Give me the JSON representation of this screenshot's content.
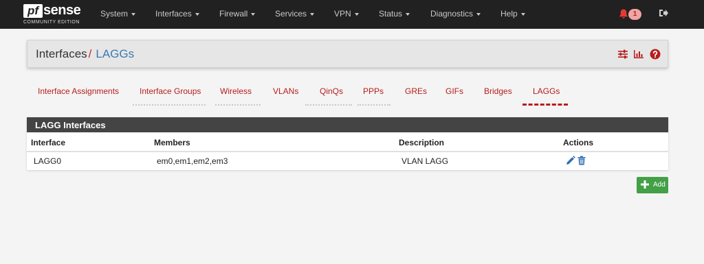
{
  "brand": {
    "logo_pf": "pf",
    "logo_sense": "sense",
    "edition": "COMMUNITY EDITION"
  },
  "nav": {
    "items": [
      "System",
      "Interfaces",
      "Firewall",
      "Services",
      "VPN",
      "Status",
      "Diagnostics",
      "Help"
    ],
    "notification_count": "1"
  },
  "breadcrumb": {
    "parent": "Interfaces",
    "separator": "/",
    "current": "LAGGs"
  },
  "tabs": [
    "Interface Assignments",
    "Interface Groups",
    "Wireless",
    "VLANs",
    "QinQs",
    "PPPs",
    "GREs",
    "GIFs",
    "Bridges",
    "LAGGs"
  ],
  "active_tab": "LAGGs",
  "panel": {
    "title": "LAGG Interfaces",
    "columns": [
      "Interface",
      "Members",
      "Description",
      "Actions"
    ],
    "rows": [
      {
        "interface": "LAGG0",
        "members": "em0,em1,em2,em3",
        "description": "VLAN LAGG"
      }
    ]
  },
  "add_button": {
    "label": "Add"
  },
  "colors": {
    "navbar": "#212121",
    "accent_red": "#b71c1c",
    "link_blue": "#3c78b5",
    "add_green": "#43a047",
    "panel_heading": "#444444"
  },
  "icons": [
    "bell-icon",
    "logout-icon",
    "sliders-icon",
    "bar-chart-icon",
    "help-icon",
    "pencil-icon",
    "trash-icon",
    "plus-icon"
  ]
}
